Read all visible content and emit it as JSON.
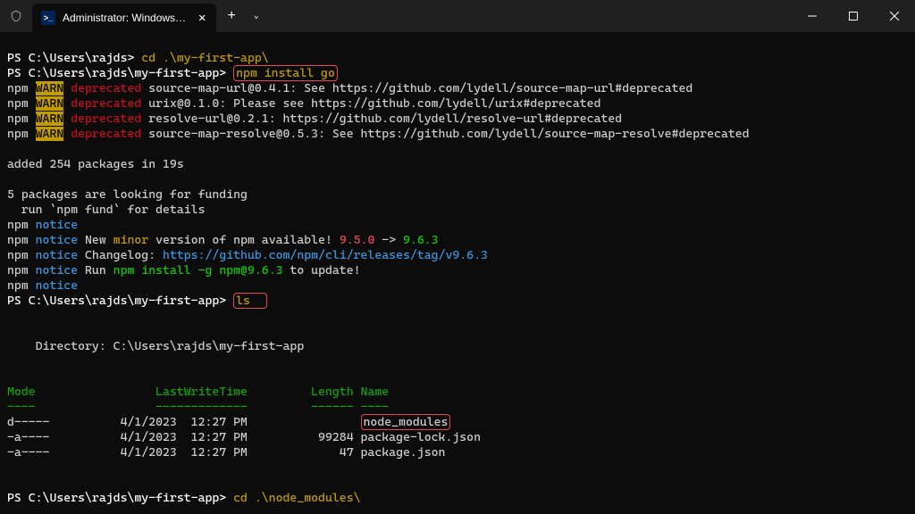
{
  "titlebar": {
    "tab_title": "Administrator: Windows Powe…",
    "add_label": "+",
    "dropdown_label": "⌄"
  },
  "line1": {
    "prompt": "PS C:\\Users\\rajds> ",
    "cmd": "cd .\\my-first-app\\"
  },
  "line2": {
    "prompt": "PS C:\\Users\\rajds\\my-first-app> ",
    "cmd": "npm install go"
  },
  "warn1": {
    "npm": "npm ",
    "warn": "WARN",
    "sp": " ",
    "dep": "deprecated",
    "msg": " source-map-url@0.4.1: See https://github.com/lydell/source-map-url#deprecated"
  },
  "warn2": {
    "npm": "npm ",
    "warn": "WARN",
    "sp": " ",
    "dep": "deprecated",
    "msg": " urix@0.1.0: Please see https://github.com/lydell/urix#deprecated"
  },
  "warn3": {
    "npm": "npm ",
    "warn": "WARN",
    "sp": " ",
    "dep": "deprecated",
    "msg": " resolve-url@0.2.1: https://github.com/lydell/resolve-url#deprecated"
  },
  "warn4": {
    "npm": "npm ",
    "warn": "WARN",
    "sp": " ",
    "dep": "deprecated",
    "msg": " source-map-resolve@0.5.3: See https://github.com/lydell/source-map-resolve#deprecated"
  },
  "blank": " ",
  "added": "added 254 packages in 19s",
  "funding1": "5 packages are looking for funding",
  "funding2": "  run `npm fund` for details",
  "n1": {
    "npm": "npm ",
    "notice": "notice"
  },
  "n2": {
    "npm": "npm ",
    "notice": "notice",
    "p1": " New ",
    "minor": "minor",
    "p2": " version of npm available! ",
    "v1": "9.5.0",
    "arrow": " -> ",
    "v2": "9.6.3"
  },
  "n3": {
    "npm": "npm ",
    "notice": "notice",
    "p1": " Changelog: ",
    "url": "https://github.com/npm/cli/releases/tag/v9.6.3"
  },
  "n4": {
    "npm": "npm ",
    "notice": "notice",
    "p1": " Run ",
    "cmd": "npm install -g npm@9.6.3",
    "p2": " to update!"
  },
  "n5": {
    "npm": "npm ",
    "notice": "notice"
  },
  "line3": {
    "prompt": "PS C:\\Users\\rajds\\my-first-app> ",
    "cmd": "ls",
    "pad": "  "
  },
  "dir": "    Directory: C:\\Users\\rajds\\my-first-app",
  "head": {
    "mode": "Mode",
    "sp1": "                 ",
    "lwt": "LastWriteTime",
    "sp2": "         ",
    "len": "Length",
    "sp3": " ",
    "name": "Name"
  },
  "sep": {
    "mode": "----",
    "sp1": "                 ",
    "lwt": "-------------",
    "sp2": "         ",
    "len": "------",
    "sp3": " ",
    "name": "----"
  },
  "r1": {
    "pre": "d-----          4/1/2023  12:27 PM                ",
    "name": "node_modules"
  },
  "r2": {
    "pre": "-a----          4/1/2023  12:27 PM          99284 ",
    "name": "package-lock.json"
  },
  "r3": {
    "pre": "-a----          4/1/2023  12:27 PM             47 ",
    "name": "package.json"
  },
  "line4": {
    "prompt": "PS C:\\Users\\rajds\\my-first-app> ",
    "cmd": "cd .\\node_modules\\"
  }
}
